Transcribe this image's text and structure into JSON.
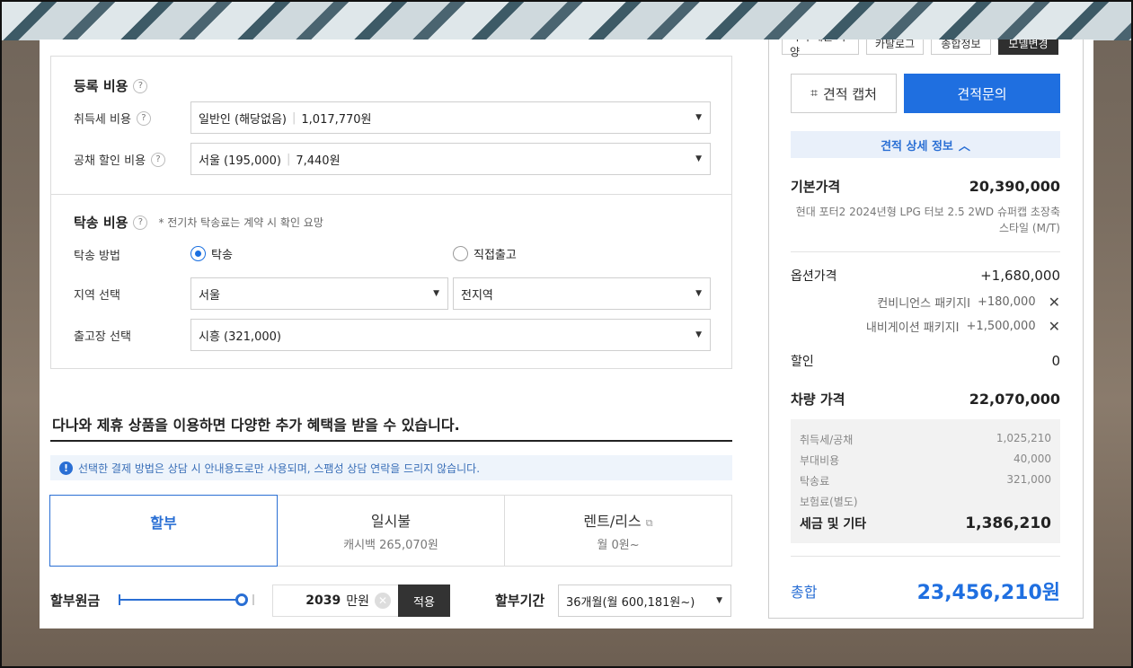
{
  "registration": {
    "title": "등록 비용",
    "help": "?",
    "acquisition_label": "취득세 비용",
    "acquisition_type": "일반인 (해당없음)",
    "acquisition_amount": "1,017,770원",
    "bond_label": "공채 할인 비용",
    "bond_type": "서울 (195,000)",
    "bond_amount": "7,440원"
  },
  "delivery": {
    "title": "탁송 비용",
    "note": "* 전기차 탁송료는 계약 시 확인 요망",
    "method_label": "탁송 방법",
    "option_delivery": "탁송",
    "option_pickup": "직접출고",
    "region_label": "지역 선택",
    "region_1": "서울",
    "region_2": "전지역",
    "factory_label": "출고장 선택",
    "factory": "시흥 (321,000)"
  },
  "promo": {
    "heading": "다나와 제휴 상품을 이용하면 다양한 추가 혜택을 받을 수 있습니다.",
    "notice": "선택한 결제 방법은 상담 시 안내용도로만 사용되며, 스팸성 상담 연락을 드리지 않습니다."
  },
  "payment_tabs": [
    {
      "label": "할부",
      "sub": ""
    },
    {
      "label": "일시불",
      "sub": "캐시백 265,070원"
    },
    {
      "label": "렌트/리스",
      "sub": "월 0원~"
    }
  ],
  "installment": {
    "principal_label": "할부원금",
    "amount_value": "2039",
    "amount_unit": "만원",
    "apply": "적용",
    "period_label": "할부기간",
    "period_value": "36개월(월 600,181원~)",
    "slider_fraction": 1.0
  },
  "summary": {
    "top_tabs": [
      "가격·제원·사양",
      "카탈로그",
      "종합정보",
      "모델변경"
    ],
    "capture": "견적 캡처",
    "inquiry": "견적문의",
    "detail_toggle": "견적 상세 정보",
    "base_price_label": "기본가격",
    "base_price": "20,390,000",
    "model_desc": "현대 포터2 2024년형 LPG 터보 2.5 2WD 슈퍼캡 초장축 스타일 (M/T)",
    "option_label": "옵션가격",
    "option_total": "+1,680,000",
    "options": [
      {
        "name": "컨비니언스 패키지Ⅰ",
        "price": "+180,000"
      },
      {
        "name": "내비게이션 패키지Ⅰ",
        "price": "+1,500,000"
      }
    ],
    "discount_label": "할인",
    "discount": "0",
    "vehicle_price_label": "차량 가격",
    "vehicle_price": "22,070,000",
    "taxes": [
      {
        "k": "취득세/공채",
        "v": "1,025,210"
      },
      {
        "k": "부대비용",
        "v": "40,000"
      },
      {
        "k": "탁송료",
        "v": "321,000"
      },
      {
        "k": "보험료(별도)",
        "v": ""
      }
    ],
    "tax_total_label": "세금 및 기타",
    "tax_total": "1,386,210",
    "grand_label": "총합",
    "grand_total": "23,456,210원"
  },
  "colors": {
    "accent": "#1f6fe0",
    "dark_button": "#333333"
  }
}
